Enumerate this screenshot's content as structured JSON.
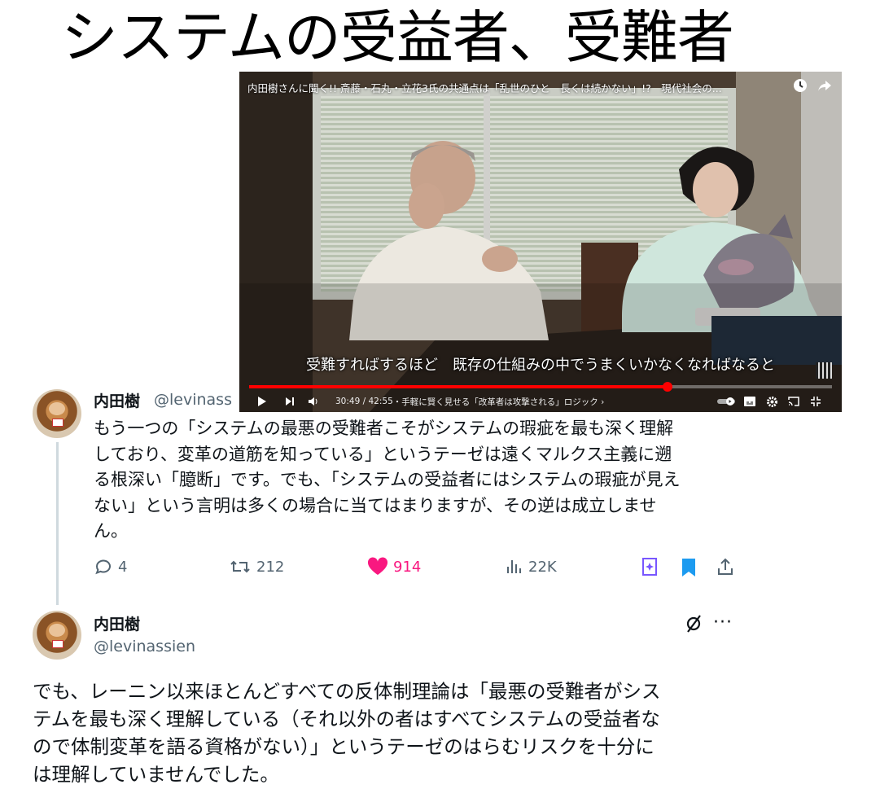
{
  "headline": "システムの受益者、受難者",
  "video": {
    "title": "内田樹さんに聞く!! 斎藤・石丸・立花3氏の共通点は「乱世のひと　長くは続かない」!?　現代社会の...",
    "subtitle": "受難すればするほど　既存の仕組みの中でうまくいかなくなればなると",
    "time_current": "30:49",
    "time_total": "42:55",
    "chapter": "・手軽に賢く見せる「改革者は攻撃される」ロジック ›",
    "progress": 0.718,
    "icons": [
      "clock-icon",
      "share-icon",
      "play-icon",
      "next-icon",
      "volume-icon",
      "autoplay-toggle-icon",
      "captions-icon",
      "settings-icon",
      "cast-icon",
      "exit-fullscreen-icon"
    ],
    "accent_color": "#ff0000"
  },
  "tweet1": {
    "name": "内田樹",
    "handle": "@levinass",
    "lines": [
      "もう一つの「システムの最悪の受難者こそがシステムの瑕疵を最も深く理解",
      "しており、変革の道筋を知っている」というテーゼは遠くマルクス主義に遡",
      "る根深い「臆断」です。でも、「システムの受益者にはシステムの瑕疵が見え",
      "ない」という言明は多くの場合に当てはまりますが、その逆は成立しませ",
      "ん。"
    ],
    "replies": "4",
    "retweets": "212",
    "likes": "914",
    "views": "22K",
    "like_color": "#f91880",
    "bookmark_color": "#1d9bf0"
  },
  "tweet2": {
    "name": "内田樹",
    "handle": "@levinassien",
    "lines": [
      "でも、レーニン以来ほとんどすべての反体制理論は「最悪の受難者がシス",
      "テムを最も深く理解している（それ以外の者はすべてシステムの受益者な",
      "ので体制変革を語る資格がない）」というテーゼのはらむリスクを十分に",
      "は理解していませんでした。"
    ],
    "more": "···"
  }
}
